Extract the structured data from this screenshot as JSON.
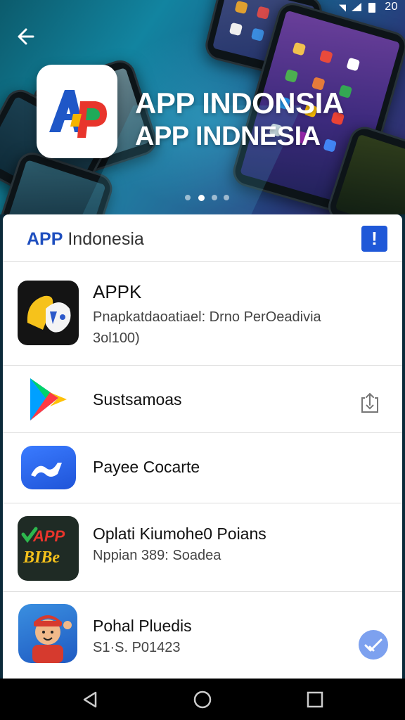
{
  "status_bar": {
    "time": "20",
    "icons": [
      "wifi-icon",
      "signal-icon",
      "battery-icon"
    ]
  },
  "hero": {
    "title_line1": "APP INDONSIA",
    "title_line2": "APP INDNESIA",
    "logo": {
      "lettering": "Ap",
      "colors": [
        "#1f57c7",
        "#e8352c",
        "#f4b400",
        "#1faa59"
      ]
    },
    "carousel": {
      "page_count": 4,
      "active_index": 1
    }
  },
  "header": {
    "brand": "APP",
    "title": "Indonesia",
    "info_label": "!"
  },
  "apps": [
    {
      "icon": "appk-logo-icon",
      "title": "APPK",
      "subtitle_line1": "Pnapkatdaoatiael: Drno PerOeadivia",
      "subtitle_line2": "3ol100)"
    },
    {
      "icon": "play-store-icon",
      "title": "Sustsamoas",
      "action_icon": "share-icon"
    },
    {
      "icon": "payee-logo-icon",
      "title": "Payee Cocarte"
    },
    {
      "icon": "app-bibe-logo-icon",
      "icon_text_top": "APP",
      "icon_text_bottom": "BIBe",
      "title": "Oplati Kiumohe0 Poians",
      "subtitle": "Nppian 389: Soadea"
    },
    {
      "icon": "character-avatar-icon",
      "title": "Pohal Pluedis",
      "subtitle": "S1·S. P01423",
      "action_icon": "check-icon"
    }
  ],
  "navbar": {
    "buttons": [
      "back-nav-icon",
      "home-nav-icon",
      "recents-nav-icon"
    ]
  },
  "colors": {
    "accent": "#1f58d8",
    "header_brand": "#1f4fbf",
    "divider": "#dcdcdc",
    "check_badge": "#7da1ef"
  }
}
